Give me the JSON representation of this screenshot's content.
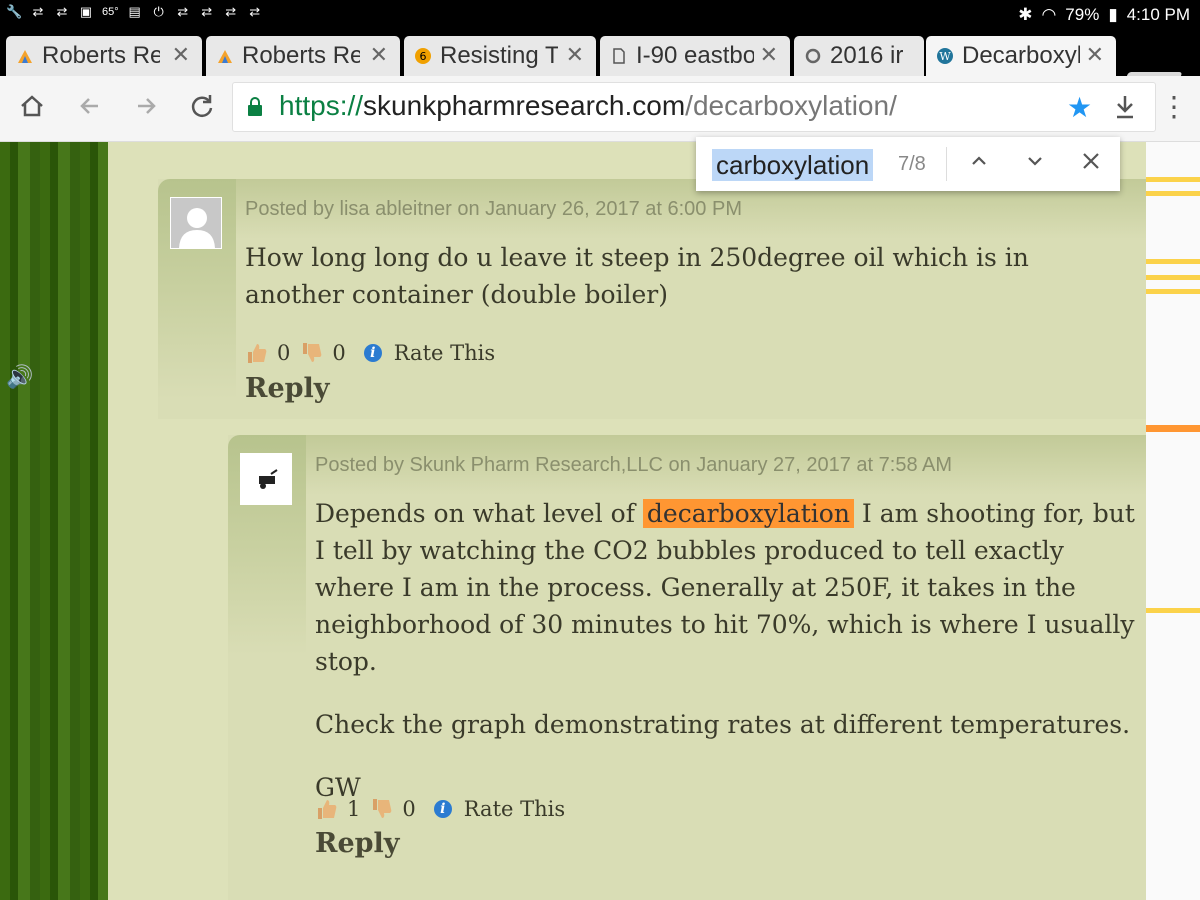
{
  "status_bar": {
    "temperature": "65°",
    "battery": "79%",
    "time": "4:10 PM"
  },
  "tabs": [
    {
      "title": "Roberts Re",
      "favicon": "roberts-favicon",
      "active": false
    },
    {
      "title": "Roberts Re",
      "favicon": "roberts-favicon",
      "active": false
    },
    {
      "title": "Resisting T",
      "favicon": "resisting-favicon",
      "active": false
    },
    {
      "title": "I-90 eastbo",
      "favicon": "page-favicon",
      "active": false
    },
    {
      "title": "2016 ir",
      "favicon": "circle-favicon",
      "active": false
    },
    {
      "title": "Decarboxyl",
      "favicon": "wordpress-favicon",
      "active": true
    }
  ],
  "address_bar": {
    "scheme": "https://",
    "host": "skunkpharmresearch.com",
    "path": "/decarboxylation/"
  },
  "find_bar": {
    "query": "carboxylation",
    "count": "7/8"
  },
  "comments": [
    {
      "meta": "Posted by lisa ableitner on January 26, 2017 at 6:00 PM",
      "body": [
        "How long long do u leave it steep in 250degree oil which is in another container (double boiler)"
      ],
      "thumbs_up": "0",
      "thumbs_down": "0",
      "rate_label": "Rate This",
      "reply_label": "Reply"
    },
    {
      "meta": "Posted by Skunk Pharm Research,LLC on January 27, 2017 at 7:58 AM",
      "body_pre": "Depends on what level of ",
      "body_highlight": "decarboxylation",
      "body_post": " I am shooting for, but I tell by watching the CO2 bubbles produced to tell exactly where I am in the process. Generally at 250F, it takes in the neighborhood of 30 minutes to hit 70%, which is where I usually stop.",
      "body_p2": "Check the graph demonstrating rates at different temperatures.",
      "body_p3": "GW",
      "thumbs_up": "1",
      "thumbs_down": "0",
      "rate_label": "Rate This",
      "reply_label": "Reply"
    }
  ]
}
